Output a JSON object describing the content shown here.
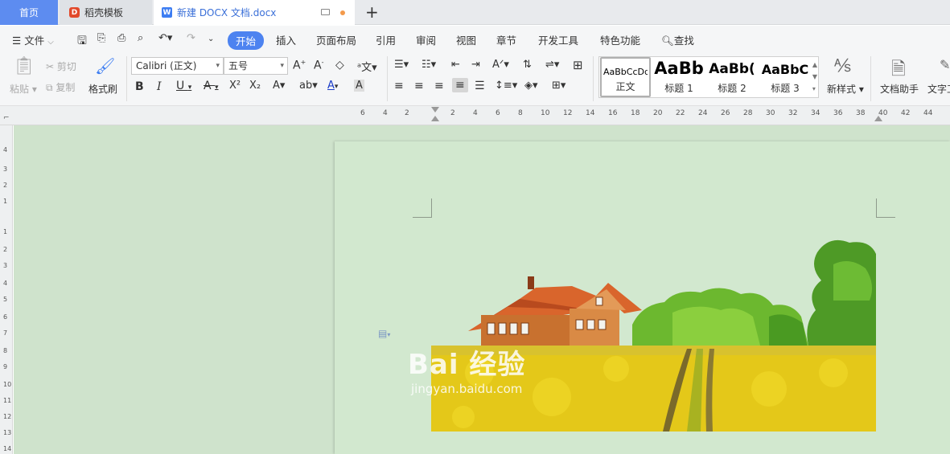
{
  "tabs": {
    "home": "首页",
    "docer": "稻壳模板",
    "document": "新建 DOCX 文档.docx",
    "new_tab": "+"
  },
  "menu": {
    "file": "文件",
    "items": [
      "开始",
      "插入",
      "页面布局",
      "引用",
      "审阅",
      "视图",
      "章节",
      "开发工具",
      "特色功能"
    ],
    "active": "开始",
    "search": "查找"
  },
  "ribbon": {
    "paste": "粘贴",
    "cut": "剪切",
    "copy": "复制",
    "format_painter": "格式刷",
    "font_name": "Calibri (正文)",
    "font_size": "五号",
    "styles": [
      {
        "sample": "AaBbCcDd",
        "name": "正文"
      },
      {
        "sample": "AaBb",
        "name": "标题 1"
      },
      {
        "sample": "AaBb(",
        "name": "标题 2"
      },
      {
        "sample": "AaBbC",
        "name": "标题 3"
      }
    ],
    "new_style": "新样式",
    "doc_assistant": "文档助手",
    "text_tool": "文字工"
  },
  "ruler": {
    "top": [
      "6",
      "4",
      "2",
      "2",
      "4",
      "6",
      "8",
      "10",
      "12",
      "14",
      "16",
      "18",
      "20",
      "22",
      "24",
      "26",
      "28",
      "30",
      "32",
      "34",
      "36",
      "38",
      "40",
      "42",
      "44"
    ],
    "left": [
      "4",
      "3",
      "2",
      "1",
      "1",
      "2",
      "3",
      "4",
      "5",
      "6",
      "7",
      "8",
      "9",
      "10",
      "11",
      "12",
      "13",
      "14"
    ]
  },
  "watermark": {
    "text": "Bai 经验",
    "url": "jingyan.baidu.com"
  },
  "colors": {
    "accent": "#4d83f0",
    "canvas_bg": "#cfe3cc",
    "page_bg": "#d2e8cf",
    "field_yellow": "#e4c819",
    "roof_orange": "#d9652c",
    "tree_green": "#5aa82c"
  }
}
